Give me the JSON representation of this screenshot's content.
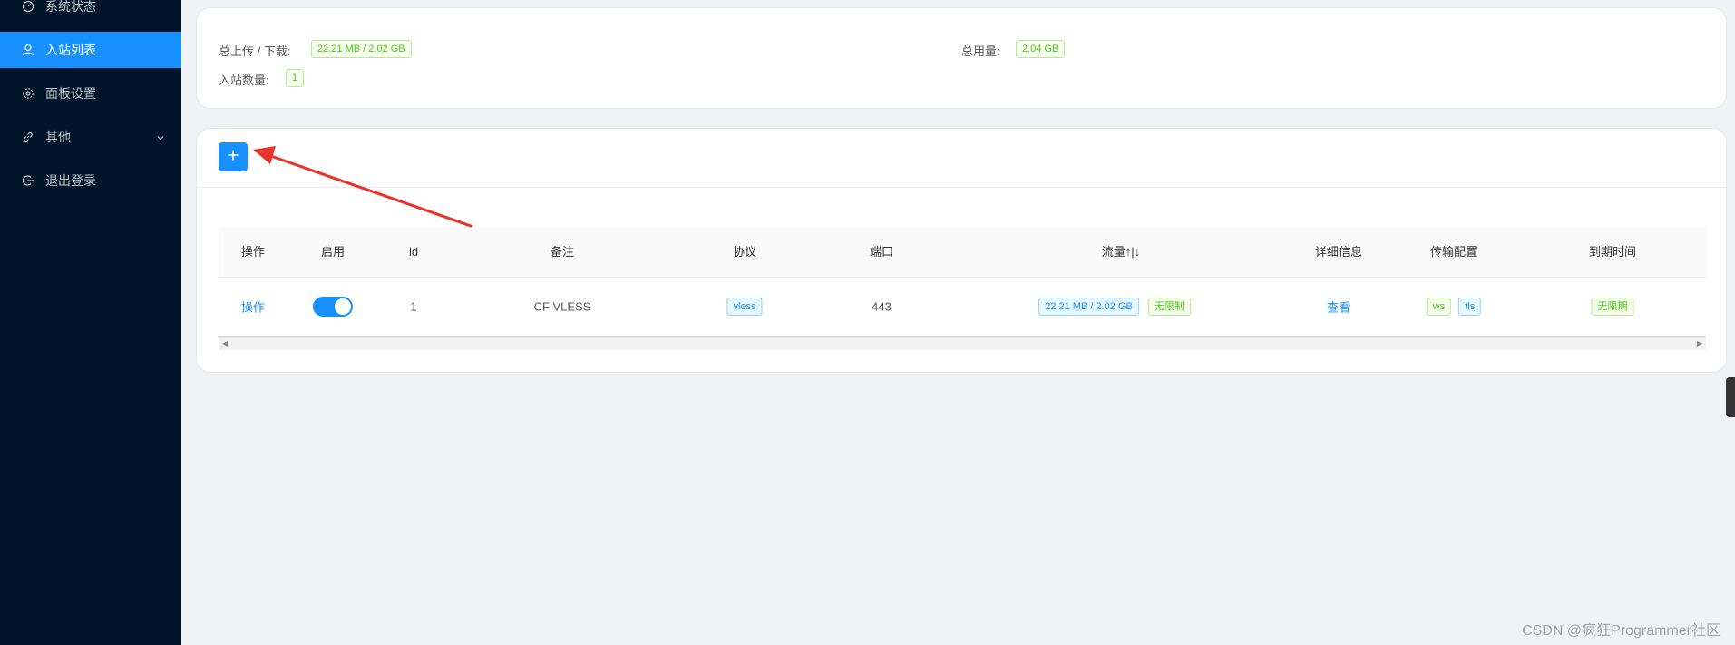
{
  "sidebar": {
    "items": [
      {
        "label": "系统状态",
        "icon": "dashboard-icon"
      },
      {
        "label": "入站列表",
        "icon": "user-icon",
        "active": true
      },
      {
        "label": "面板设置",
        "icon": "gear-icon"
      },
      {
        "label": "其他",
        "icon": "link-icon",
        "has_submenu": true
      },
      {
        "label": "退出登录",
        "icon": "logout-icon"
      }
    ]
  },
  "stats": {
    "total_up_down_label": "总上传 / 下载:",
    "total_up_down_value": "22.21 MB / 2.02 GB",
    "total_usage_label": "总用量:",
    "total_usage_value": "2.04 GB",
    "inbound_count_label": "入站数量:",
    "inbound_count_value": "1"
  },
  "table": {
    "headers": {
      "action": "操作",
      "enable": "启用",
      "id": "id",
      "remark": "备注",
      "protocol": "协议",
      "port": "端口",
      "traffic": "流量↑|↓",
      "details": "详细信息",
      "transport": "传输配置",
      "expiry": "到期时间"
    },
    "rows": [
      {
        "action": "操作",
        "enabled": true,
        "id": "1",
        "remark": "CF VLESS",
        "protocol": "vless",
        "port": "443",
        "traffic": "22.21 MB / 2.02 GB",
        "traffic_limit": "无限制",
        "details": "查看",
        "transport_network": "ws",
        "transport_security": "tls",
        "expiry": "无限期"
      }
    ]
  },
  "watermark": "CSDN @疯狂Programmer社区",
  "colors": {
    "sidebar_bg": "#001529",
    "accent": "#1890ff",
    "tag_green": "#52c41a",
    "annotation_arrow": "#e8332a"
  }
}
